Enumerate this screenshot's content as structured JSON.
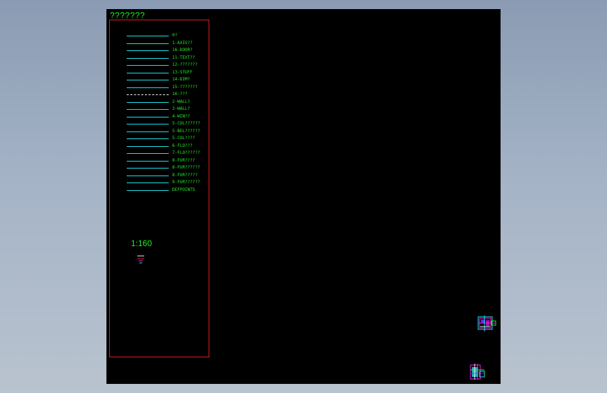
{
  "drawing": {
    "title": "???????",
    "scale": "1:160"
  },
  "layers": [
    {
      "label": "0?",
      "line": "solid"
    },
    {
      "label": "1-AXIS??",
      "line": "solid"
    },
    {
      "label": "16-DOOR?",
      "line": "solid"
    },
    {
      "label": "11-TEXT??",
      "line": "solid"
    },
    {
      "label": "12-???????",
      "line": "solid"
    },
    {
      "label": "13-STUFF",
      "line": "solid"
    },
    {
      "label": "14-DIM?",
      "line": "solid"
    },
    {
      "label": "15-???????",
      "line": "solid"
    },
    {
      "label": "16-???",
      "line": "dashed"
    },
    {
      "label": "2-WALL?",
      "line": "solid"
    },
    {
      "label": "3-WALL?",
      "line": "solid"
    },
    {
      "label": "4-WIN??",
      "line": "solid"
    },
    {
      "label": "5-COL??????",
      "line": "solid"
    },
    {
      "label": "5-BEL??????",
      "line": "solid"
    },
    {
      "label": "5-COL????",
      "line": "solid"
    },
    {
      "label": "6-FLO???",
      "line": "solid"
    },
    {
      "label": "7-FLO??????",
      "line": "solid"
    },
    {
      "label": "8-FUR????",
      "line": "solid"
    },
    {
      "label": "8-FUR??????",
      "line": "solid"
    },
    {
      "label": "8-FUR?????",
      "line": "solid"
    },
    {
      "label": "9-FUR??????",
      "line": "solid"
    },
    {
      "label": "DEFPOINTS",
      "line": "solid"
    }
  ],
  "colors": {
    "background": "#000000",
    "frame": "#e01b1b",
    "text": "#1df21d",
    "line": "#1ee0e8"
  }
}
